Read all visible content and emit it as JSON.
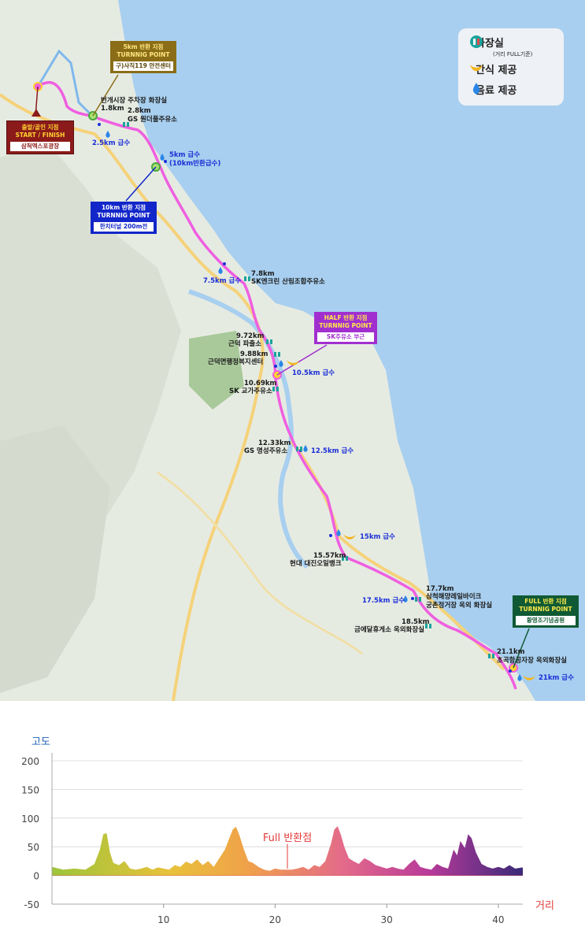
{
  "legend": {
    "restroom": "화장실",
    "restroom_note": "(거리 FULL기준)",
    "snack": "간식 제공",
    "drink": "음료 제공"
  },
  "turning_points": {
    "start": {
      "line1": "출발/골인 지점",
      "line2": "START / FINISH",
      "place": "삼척엑스포광장"
    },
    "p5k": {
      "line1": "5km 반환 지점",
      "line2": "TURNNIG POINT",
      "place": "구)사직119 안전센터"
    },
    "p10k": {
      "line1": "10km 반환 지점",
      "line2": "TURNNIG POINT",
      "place": "한치터널 200m전"
    },
    "half": {
      "line1": "HALF 반환 지점",
      "line2": "TURNNIG POINT",
      "place": "SK주유소 부근"
    },
    "full": {
      "line1": "FULL 반환 지점",
      "line2": "TURNNIG POINT",
      "place": "황영조기념공원"
    }
  },
  "map_labels": {
    "l_1_8_name": "번개시장 주차장 화장실",
    "l_1_8_km": "1.8km",
    "l_2_8_km": "2.8km",
    "l_2_8_name": "GS 원더풀주유소",
    "l_2_5": "2.5km 급수",
    "l_5_a": "5km 급수",
    "l_5_b": "(10km반환급수)",
    "l_7_5": "7.5km 급수",
    "l_7_8_km": "7.8km",
    "l_7_8_name": "SK엔크린 산림조합주유소",
    "l_9_72_km": "9.72km",
    "l_9_72_name": "근덕 파출소",
    "l_9_88_km": "9.88km",
    "l_9_88_name": "근덕면행정복지센터",
    "l_10_5": "10.5km 급수",
    "l_10_69_km": "10.69km",
    "l_10_69_name": "SK 교가주유소",
    "l_12_33_km": "12.33km",
    "l_12_33_name": "GS 명성주유소",
    "l_12_5": "12.5km 급수",
    "l_15": "15km 급수",
    "l_15_57_km": "15.57km",
    "l_15_57_name": "현대 대진오일뱅크",
    "l_17_5": "17.5km 급수",
    "l_17_7_km": "17.7km",
    "l_17_7_a": "삼척해양레일바이크",
    "l_17_7_b": "궁촌정거장 옥외 화장실",
    "l_18_5_km": "18.5km",
    "l_18_5_name": "금에달휴게소 옥외화장실",
    "l_21_1_km": "21.1km",
    "l_21_1_name": "초곡항공자장 옥외화장실",
    "l_21": "21km 급수"
  },
  "colors": {
    "route": "#ef5fe0",
    "sea": "#a8cfef",
    "land": "#e8ece4",
    "water_icon": "#2a86e6",
    "restroom_icon": "#1aa39b",
    "zero_line": "#d44a4a"
  },
  "chart_data": {
    "type": "area",
    "ylabel": "고도",
    "xlabel": "거리",
    "ylim": [
      -50,
      200
    ],
    "yticks": [
      -50,
      0,
      50,
      100,
      150,
      200
    ],
    "xlim": [
      0,
      42.195
    ],
    "xticks": [
      10,
      20,
      30,
      40
    ],
    "annotation": {
      "text": "Full 반환점",
      "x": 21.1
    },
    "x": [
      0,
      1,
      2,
      3,
      3.8,
      4.3,
      4.6,
      4.9,
      5.2,
      5.5,
      6,
      6.5,
      7,
      7.5,
      8,
      8.5,
      9,
      9.5,
      10,
      10.5,
      11,
      11.5,
      12,
      12.5,
      13,
      13.5,
      14,
      14.5,
      15,
      15.5,
      15.8,
      16.2,
      16.5,
      16.8,
      17.2,
      17.6,
      18,
      18.5,
      19,
      19.5,
      20,
      20.5,
      21,
      21.5,
      22,
      22.5,
      23,
      23.5,
      24,
      24.5,
      25,
      25.3,
      25.6,
      25.9,
      26.2,
      26.6,
      27,
      27.5,
      28,
      28.5,
      29,
      29.5,
      30,
      30.5,
      31,
      31.5,
      32,
      32.5,
      33,
      33.5,
      34,
      34.5,
      35,
      35.5,
      36,
      36.3,
      36.6,
      37,
      37.3,
      37.6,
      38,
      38.5,
      39,
      39.5,
      40,
      40.5,
      41,
      41.5,
      42.195
    ],
    "y": [
      15,
      10,
      12,
      10,
      20,
      45,
      72,
      74,
      40,
      22,
      18,
      25,
      12,
      10,
      12,
      15,
      10,
      14,
      12,
      10,
      18,
      15,
      24,
      20,
      28,
      18,
      25,
      15,
      30,
      45,
      60,
      80,
      85,
      70,
      45,
      25,
      22,
      15,
      10,
      8,
      12,
      10,
      10,
      10,
      12,
      15,
      10,
      18,
      15,
      25,
      55,
      80,
      86,
      70,
      50,
      30,
      25,
      20,
      30,
      25,
      18,
      15,
      12,
      15,
      12,
      10,
      20,
      28,
      15,
      12,
      10,
      20,
      15,
      12,
      45,
      35,
      60,
      48,
      72,
      65,
      40,
      20,
      15,
      12,
      15,
      12,
      18,
      12,
      14
    ]
  }
}
